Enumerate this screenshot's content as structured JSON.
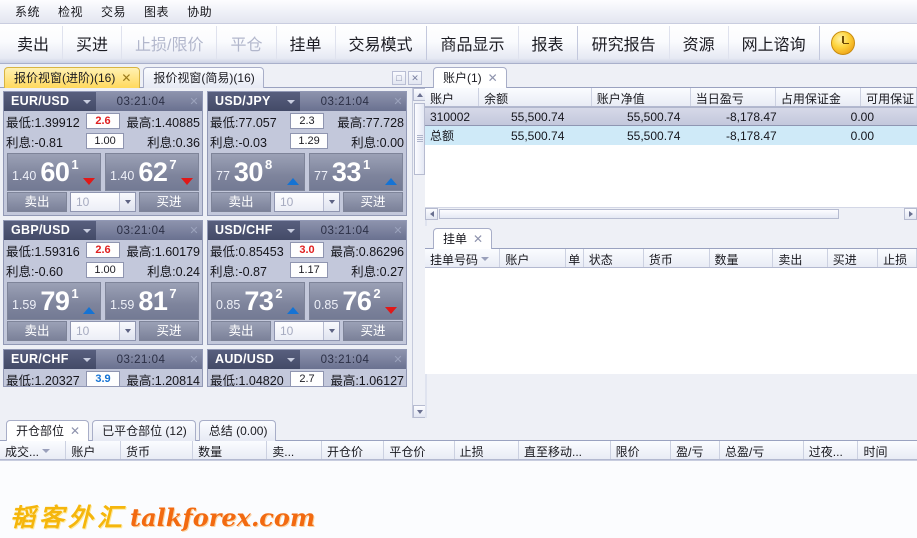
{
  "menubar": {
    "items": [
      {
        "label": "系统"
      },
      {
        "label": "检视"
      },
      {
        "label": "交易"
      },
      {
        "label": "图表"
      },
      {
        "label": "协助"
      }
    ]
  },
  "toolbar": {
    "groups": [
      {
        "buttons": [
          {
            "label": "卖出",
            "disabled": false
          },
          {
            "label": "买进",
            "disabled": false
          },
          {
            "label": "止损/限价",
            "disabled": true
          },
          {
            "label": "平仓",
            "disabled": true
          },
          {
            "label": "挂单",
            "disabled": false
          },
          {
            "label": "交易模式",
            "disabled": false
          }
        ]
      },
      {
        "buttons": [
          {
            "label": "商品显示",
            "disabled": false
          },
          {
            "label": "报表",
            "disabled": false
          }
        ]
      },
      {
        "buttons": [
          {
            "label": "研究报告",
            "disabled": false
          },
          {
            "label": "资源",
            "disabled": false
          },
          {
            "label": "网上谘询",
            "disabled": false
          }
        ]
      },
      {
        "buttons": [
          {
            "label": "",
            "icon": "clock-icon",
            "disabled": false
          }
        ]
      }
    ]
  },
  "quote_tabs": [
    {
      "label": "报价视窗(进阶)(16)",
      "active": true,
      "closable": true
    },
    {
      "label": "报价视窗(简易)(16)",
      "active": false,
      "closable": false
    }
  ],
  "quote_labels": {
    "low_prefix": "最低:",
    "high_prefix": "最高:",
    "interest_prefix": "利息:",
    "sell": "卖出",
    "buy": "买进",
    "qty_placeholder": "10"
  },
  "quotes": [
    {
      "symbol": "EUR/USD",
      "time": "03:21:04",
      "low": "1.39912",
      "high": "1.40885",
      "spread": "2.6",
      "spread_color": "red",
      "interest_sell": "-0.81",
      "lot": "1.00",
      "interest_buy": "0.36",
      "sell": {
        "int": "1.40",
        "big": "60",
        "frac": "1",
        "arrow": "down"
      },
      "buy": {
        "int": "1.40",
        "big": "62",
        "frac": "7",
        "arrow": "down"
      },
      "clipped": false
    },
    {
      "symbol": "USD/JPY",
      "time": "03:21:04",
      "low": "77.057",
      "high": "77.728",
      "spread": "2.3",
      "spread_color": "black",
      "interest_sell": "-0.03",
      "lot": "1.29",
      "interest_buy": "0.00",
      "sell": {
        "int": "77",
        "big": "30",
        "frac": "8",
        "arrow": "up"
      },
      "buy": {
        "int": "77",
        "big": "33",
        "frac": "1",
        "arrow": "up"
      },
      "clipped": false
    },
    {
      "symbol": "GBP/USD",
      "time": "03:21:04",
      "low": "1.59316",
      "high": "1.60179",
      "spread": "2.6",
      "spread_color": "red",
      "interest_sell": "-0.60",
      "lot": "1.00",
      "interest_buy": "0.24",
      "sell": {
        "int": "1.59",
        "big": "79",
        "frac": "1",
        "arrow": "up"
      },
      "buy": {
        "int": "1.59",
        "big": "81",
        "frac": "7",
        "arrow": "none"
      },
      "clipped": false
    },
    {
      "symbol": "USD/CHF",
      "time": "03:21:04",
      "low": "0.85453",
      "high": "0.86296",
      "spread": "3.0",
      "spread_color": "red",
      "interest_sell": "-0.87",
      "lot": "1.17",
      "interest_buy": "0.27",
      "sell": {
        "int": "0.85",
        "big": "73",
        "frac": "2",
        "arrow": "up"
      },
      "buy": {
        "int": "0.85",
        "big": "76",
        "frac": "2",
        "arrow": "down"
      },
      "clipped": false
    },
    {
      "symbol": "EUR/CHF",
      "time": "03:21:04",
      "low": "1.20327",
      "high": "1.20814",
      "spread": "3.9",
      "spread_color": "blue",
      "interest_sell": "",
      "lot": "",
      "interest_buy": "",
      "sell": {
        "int": "",
        "big": "",
        "frac": "",
        "arrow": "none"
      },
      "buy": {
        "int": "",
        "big": "",
        "frac": "",
        "arrow": "none"
      },
      "clipped": true
    },
    {
      "symbol": "AUD/USD",
      "time": "03:21:04",
      "low": "1.04820",
      "high": "1.06127",
      "spread": "2.7",
      "spread_color": "black",
      "interest_sell": "",
      "lot": "",
      "interest_buy": "",
      "sell": {
        "int": "",
        "big": "",
        "frac": "",
        "arrow": "none"
      },
      "buy": {
        "int": "",
        "big": "",
        "frac": "",
        "arrow": "none"
      },
      "clipped": true
    }
  ],
  "account_panel": {
    "tab": {
      "label": "账户(1)",
      "closable": true
    },
    "columns": [
      "账户",
      "余额",
      "账户净值",
      "当日盈亏",
      "占用保证金",
      "可用保证"
    ],
    "rows": [
      {
        "cells": [
          "310002",
          "55,500.74",
          "55,500.74",
          "-8,178.47",
          "0.00",
          ""
        ],
        "selected": true
      },
      {
        "cells": [
          "总额",
          "55,500.74",
          "55,500.74",
          "-8,178.47",
          "0.00",
          ""
        ],
        "total": true
      }
    ]
  },
  "pending_panel": {
    "tab": {
      "label": "挂单",
      "closable": true
    },
    "columns": [
      "挂单号码",
      "账户",
      "单",
      "状态",
      "货币",
      "数量",
      "卖出",
      "买进",
      "止损"
    ],
    "rows": []
  },
  "bottom_panel": {
    "tabs": [
      {
        "label": "开仓部位",
        "active": true,
        "closable": true
      },
      {
        "label": "已平仓部位 (12)",
        "active": false,
        "closable": false
      },
      {
        "label": "总结 (0.00)",
        "active": false,
        "closable": false
      }
    ],
    "columns": [
      "成交...",
      "账户",
      "货币",
      "数量",
      "卖...",
      "开仓价",
      "平仓价",
      "止损",
      "直至移动...",
      "限价",
      "盈/亏",
      "总盈/亏",
      "过夜...",
      "时间"
    ],
    "rows": []
  },
  "watermark": {
    "cn": "韬客外汇",
    "en": "talkforex.com"
  }
}
